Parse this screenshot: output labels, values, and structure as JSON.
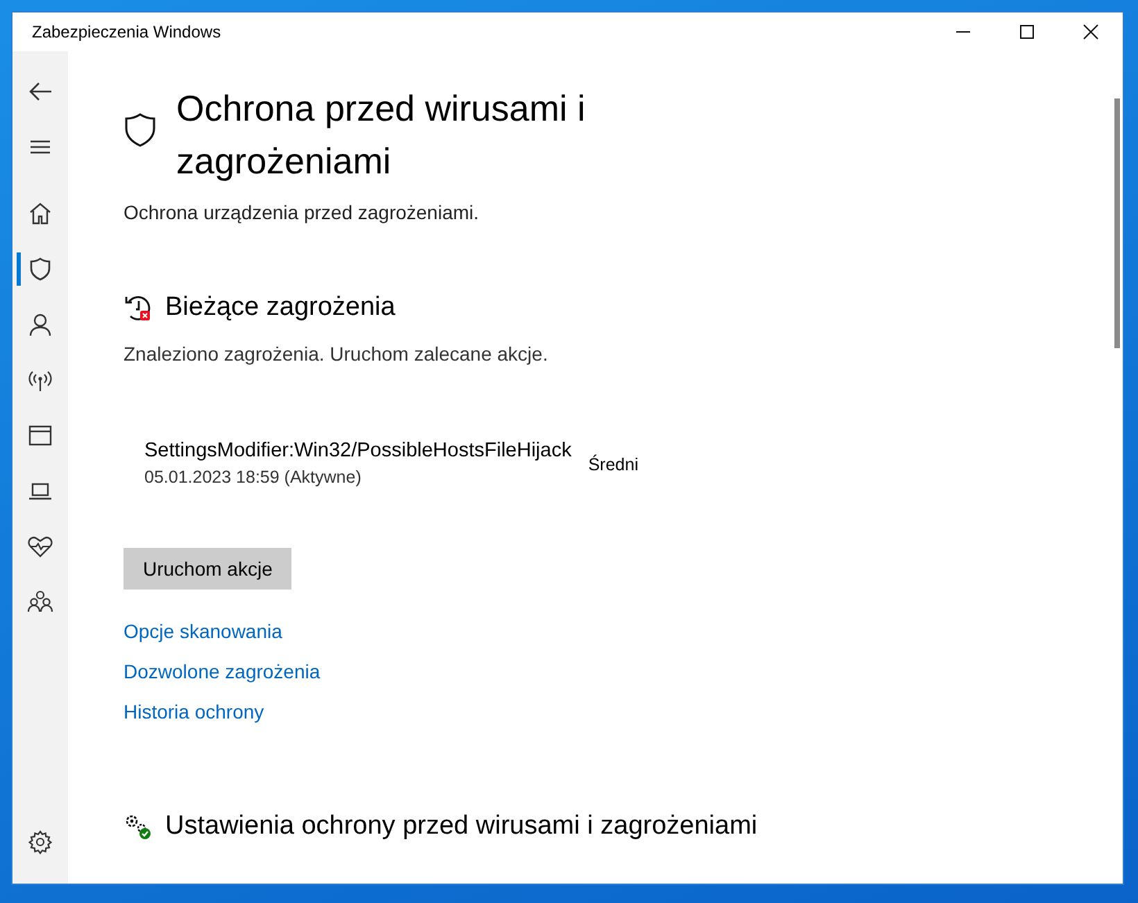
{
  "window": {
    "title": "Zabezpieczenia Windows"
  },
  "nav": {
    "items": [
      {
        "selected": false
      },
      {
        "selected": false
      },
      {
        "selected": false
      },
      {
        "selected": true
      },
      {
        "selected": false
      },
      {
        "selected": false
      },
      {
        "selected": false
      },
      {
        "selected": false
      },
      {
        "selected": false
      },
      {
        "selected": false
      }
    ],
    "bottom": [
      {
        "selected": false
      }
    ]
  },
  "page": {
    "title": "Ochrona przed wirusami i zagrożeniami",
    "subtitle": "Ochrona urządzenia przed zagrożeniami."
  },
  "current_threats": {
    "heading": "Bieżące zagrożenia",
    "description": "Znaleziono zagrożenia. Uruchom zalecane akcje.",
    "threats": [
      {
        "name": "SettingsModifier:Win32/PossibleHostsFileHijack",
        "date": "05.01.2023 18:59 (Aktywne)",
        "severity": "Średni"
      }
    ],
    "action_button": "Uruchom akcje",
    "links": [
      "Opcje skanowania",
      "Dozwolone zagrożenia",
      "Historia ochrony"
    ]
  },
  "settings_section": {
    "heading": "Ustawienia ochrony przed wirusami i zagrożeniami"
  }
}
